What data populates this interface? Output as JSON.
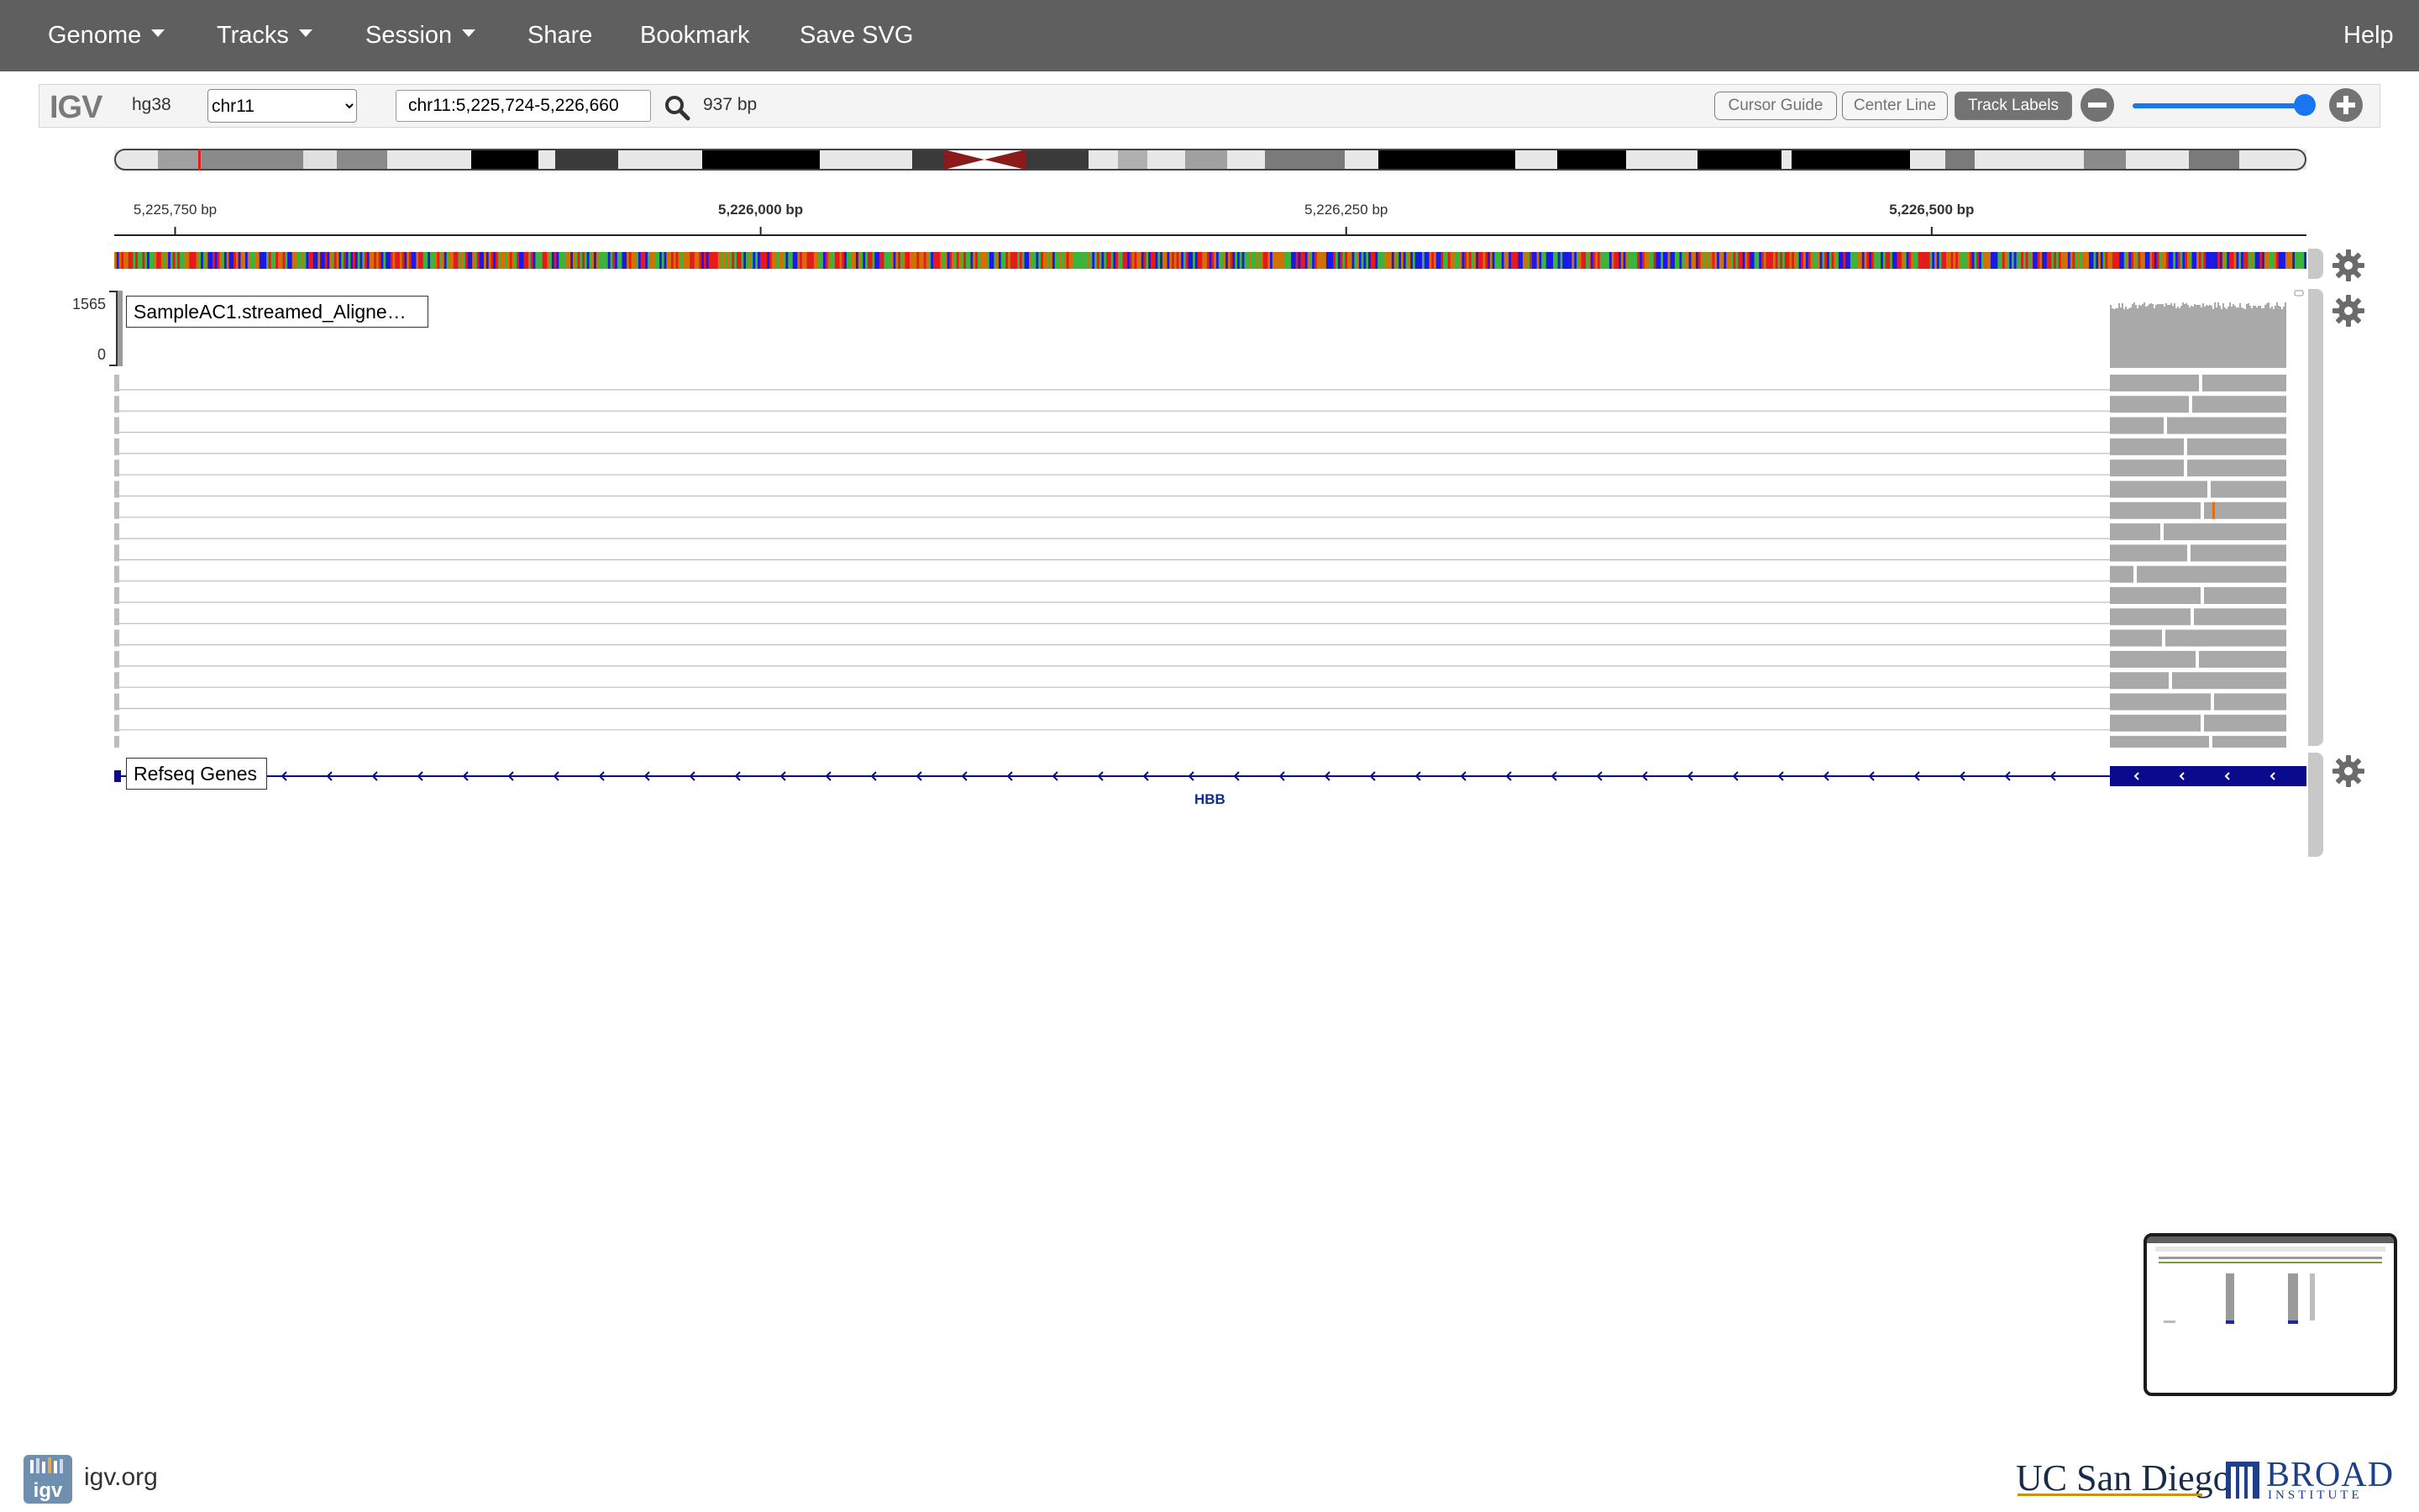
{
  "navbar": {
    "genome": "Genome",
    "tracks": "Tracks",
    "session": "Session",
    "share": "Share",
    "bookmark": "Bookmark",
    "save_svg": "Save SVG",
    "help": "Help"
  },
  "igv": {
    "logo": "IGV",
    "genome_id": "hg38",
    "chromosome": "chr11",
    "chromosome_options": [
      "chr11"
    ],
    "locus": "chr11:5,225,724-5,226,660",
    "width": "937 bp",
    "cursor_guide": "Cursor Guide",
    "center_line": "Center Line",
    "track_labels": "Track Labels",
    "track_labels_active": true
  },
  "ruler": {
    "ticks": [
      "5,225,750 bp",
      "5,226,000 bp",
      "5,226,250 bp",
      "5,226,500 bp"
    ],
    "tick_positions": [
      5225750,
      5226000,
      5226250,
      5226500
    ],
    "range": [
      5225724,
      5226660
    ]
  },
  "tracks": {
    "alignment": {
      "label": "SampleAC1.streamed_Aligne…",
      "scale_max": "1565",
      "scale_min": "0",
      "mismatch_color": "#d9711c"
    },
    "genes": {
      "label": "Refseq Genes",
      "gene_name": "HBB",
      "color": "#0a0a8c"
    }
  },
  "colors": {
    "navbar": "#5f5f5f",
    "accent": "#1976f0",
    "alignment_gray": "#a9a9a9",
    "centromere": "#8b1a1a"
  },
  "footer": {
    "link": "igv.org",
    "ucsd": "UC San Diego",
    "broad": "BROAD",
    "broad_sub": "INSTITUTE"
  }
}
